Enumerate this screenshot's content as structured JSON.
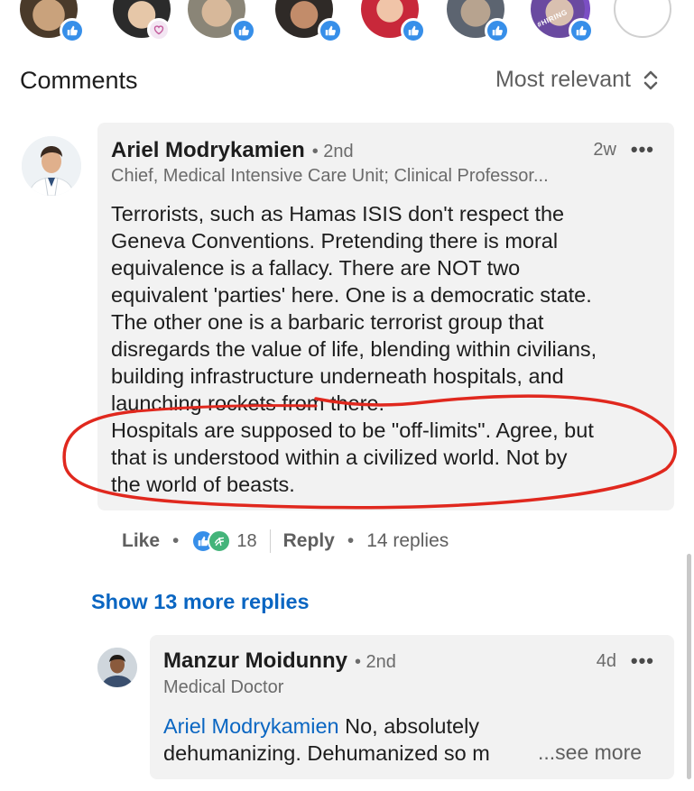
{
  "reactors": {
    "hiring_badge": "#HIRING"
  },
  "comments_section": {
    "title": "Comments",
    "sort_label": "Most relevant"
  },
  "comment": {
    "author": "Ariel Modrykamien",
    "degree": "• 2nd",
    "headline": "Chief, Medical Intensive Care Unit; Clinical Professor...",
    "time": "2w",
    "more": "•••",
    "body_lines": [
      "Terrorists, such as Hamas ISIS don't respect the",
      "Geneva Conventions. Pretending there is moral",
      "equivalence is a fallacy. There are NOT two",
      "equivalent 'parties' here. One is a democratic state.",
      "The other one is a barbaric terrorist group that",
      "disregards the value of life, blending within civilians,",
      "building infrastructure underneath hospitals, and",
      "launching rockets from there.",
      "Hospitals are supposed to be \"off-limits\". Agree, but",
      "that is understood within a civilized world. Not by",
      "the world of beasts."
    ],
    "like_label": "Like",
    "reaction_count": "18",
    "reply_label": "Reply",
    "replies_count": "14 replies",
    "separator": "•"
  },
  "show_more_replies": "Show 13 more replies",
  "reply": {
    "author": "Manzur Moidunny",
    "degree": "• 2nd",
    "headline": "Medical Doctor",
    "time": "4d",
    "more": "•••",
    "mention": "Ariel Modrykamien",
    "text_line1": " No, absolutely",
    "text_line2": "dehumanizing. Dehumanized so m",
    "see_more": "...see more"
  },
  "colors": {
    "link_blue": "#0a66c2",
    "like_blue": "#378fe9",
    "annotation_red": "#e0281e",
    "bubble_gray": "#f2f2f2"
  }
}
